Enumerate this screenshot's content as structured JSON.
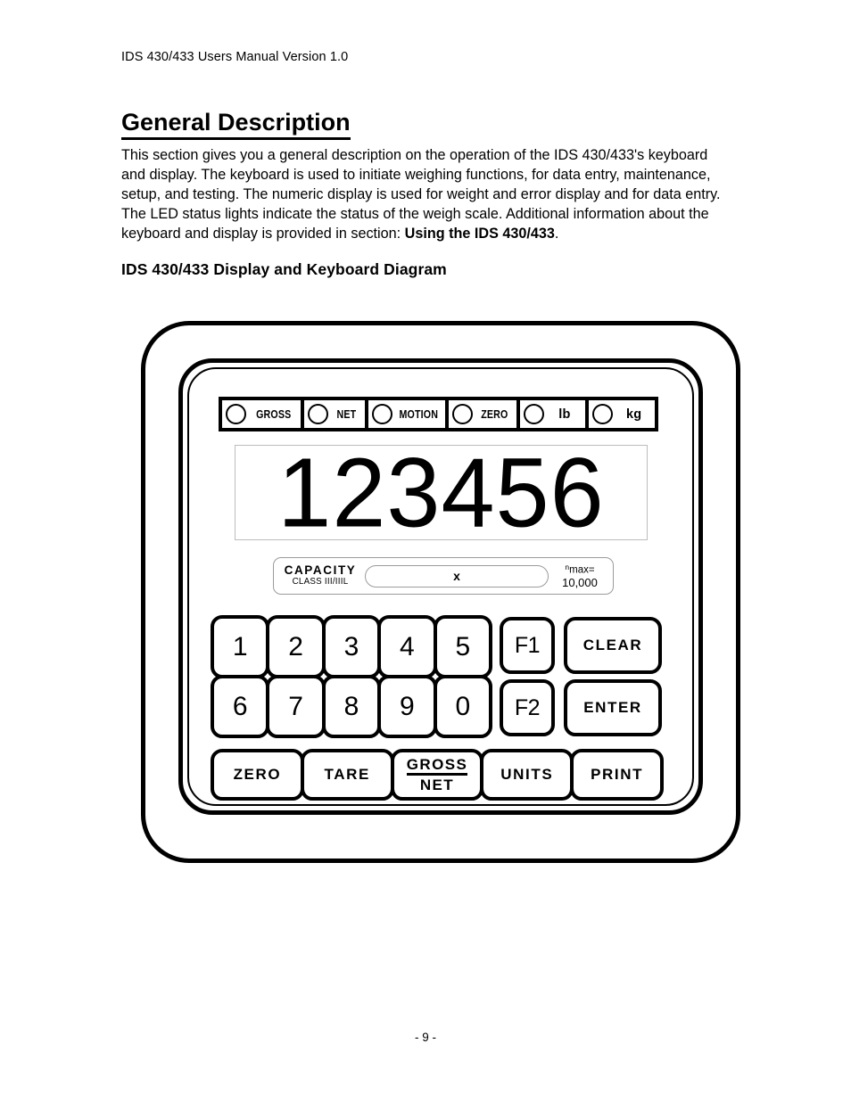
{
  "document": {
    "header": "IDS 430/433 Users Manual Version 1.0",
    "section_title": "General Description",
    "paragraph_lead": "This section gives you a general description on the operation of the IDS 430/433's keyboard and display.  The keyboard is used to initiate weighing functions, for data entry, maintenance, setup, and testing.  The numeric display is used for weight and error display and for data entry.  The LED status lights indicate the status of the weigh scale.  Additional information about the keyboard and display is provided in section: ",
    "paragraph_bold": "Using the IDS 430/433",
    "paragraph_tail": ".",
    "sub_title": "IDS 430/433 Display and Keyboard Diagram",
    "page_number": "- 9 -"
  },
  "device": {
    "status_leds": [
      {
        "label": "GROSS",
        "style": "condensed"
      },
      {
        "label": "NET",
        "style": "condensed"
      },
      {
        "label": "MOTION",
        "style": "condensed"
      },
      {
        "label": "ZERO",
        "style": "condensed"
      },
      {
        "label": "lb",
        "style": "unit"
      },
      {
        "label": "kg",
        "style": "unit"
      }
    ],
    "display": {
      "digits": "123456"
    },
    "capacity": {
      "title": "CAPACITY",
      "class": "CLASS III/IIIL",
      "value": "x",
      "nmax_label_sup": "n",
      "nmax_label": "max=",
      "nmax_value": "10,000"
    },
    "keypad": {
      "numeric": [
        "1",
        "2",
        "3",
        "4",
        "5",
        "6",
        "7",
        "8",
        "9",
        "0"
      ],
      "function": [
        "F1",
        "F2"
      ],
      "action": [
        "CLEAR",
        "ENTER"
      ],
      "bottom": [
        {
          "label": "ZERO",
          "stacked": false
        },
        {
          "label": "TARE",
          "stacked": false
        },
        {
          "label": "GROSS",
          "label2": "NET",
          "stacked": true
        },
        {
          "label": "UNITS",
          "stacked": false
        },
        {
          "label": "PRINT",
          "stacked": false
        }
      ]
    }
  },
  "colors": {
    "ink": "#000000",
    "paper": "#ffffff",
    "panel_border": "#bdbdbd"
  }
}
